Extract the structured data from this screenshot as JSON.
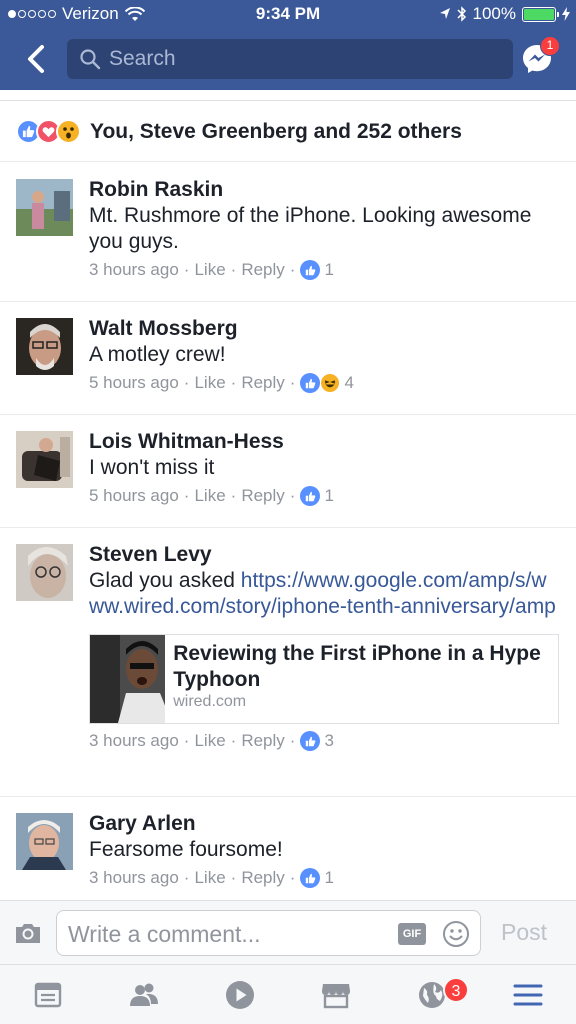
{
  "status_bar": {
    "carrier": "Verizon",
    "time": "9:34 PM",
    "battery": "100%"
  },
  "nav": {
    "search_placeholder": "Search",
    "messenger_badge": "1"
  },
  "reactions_summary": {
    "icons": [
      "like-icon",
      "love-icon",
      "wow-icon"
    ],
    "text": "You, Steve Greenberg and 252 others"
  },
  "comments": [
    {
      "name": "Robin Raskin",
      "text": "Mt. Rushmore of the iPhone.  Looking awesome you guys.",
      "time": "3 hours ago",
      "like": "Like",
      "reply": "Reply",
      "reaction_count": "1"
    },
    {
      "name": "Walt Mossberg",
      "text": "A motley crew!",
      "time": "5 hours ago",
      "like": "Like",
      "reply": "Reply",
      "reaction_count": "4"
    },
    {
      "name": "Lois Whitman-Hess",
      "text": "I won't miss it",
      "time": "5 hours ago",
      "like": "Like",
      "reply": "Reply",
      "reaction_count": "1"
    },
    {
      "name": "Steven Levy",
      "text": "Glad you asked ",
      "link": "https://www.google.com/amp/s/www.wired.com/story/iphone-tenth-anniversary/amp",
      "link_card": {
        "title": "Reviewing the First iPhone in a Hype Typhoon",
        "source": "wired.com"
      },
      "time": "3 hours ago",
      "like": "Like",
      "reply": "Reply",
      "reaction_count": "3"
    },
    {
      "name": "Gary Arlen",
      "text": "Fearsome foursome!",
      "time": "3 hours ago",
      "like": "Like",
      "reply": "Reply",
      "reaction_count": "1"
    }
  ],
  "composer": {
    "placeholder": "Write a comment...",
    "gif_label": "GIF",
    "post_label": "Post"
  },
  "tabbar": {
    "tabs": [
      "news-feed-icon",
      "friends-icon",
      "video-icon",
      "marketplace-icon",
      "notifications-icon",
      "menu-icon"
    ],
    "notifications_badge": "3"
  },
  "colors": {
    "brand": "#3b5998",
    "link": "#385898",
    "like_blue": "#5890ff",
    "badge_red": "#fa3e3e"
  }
}
